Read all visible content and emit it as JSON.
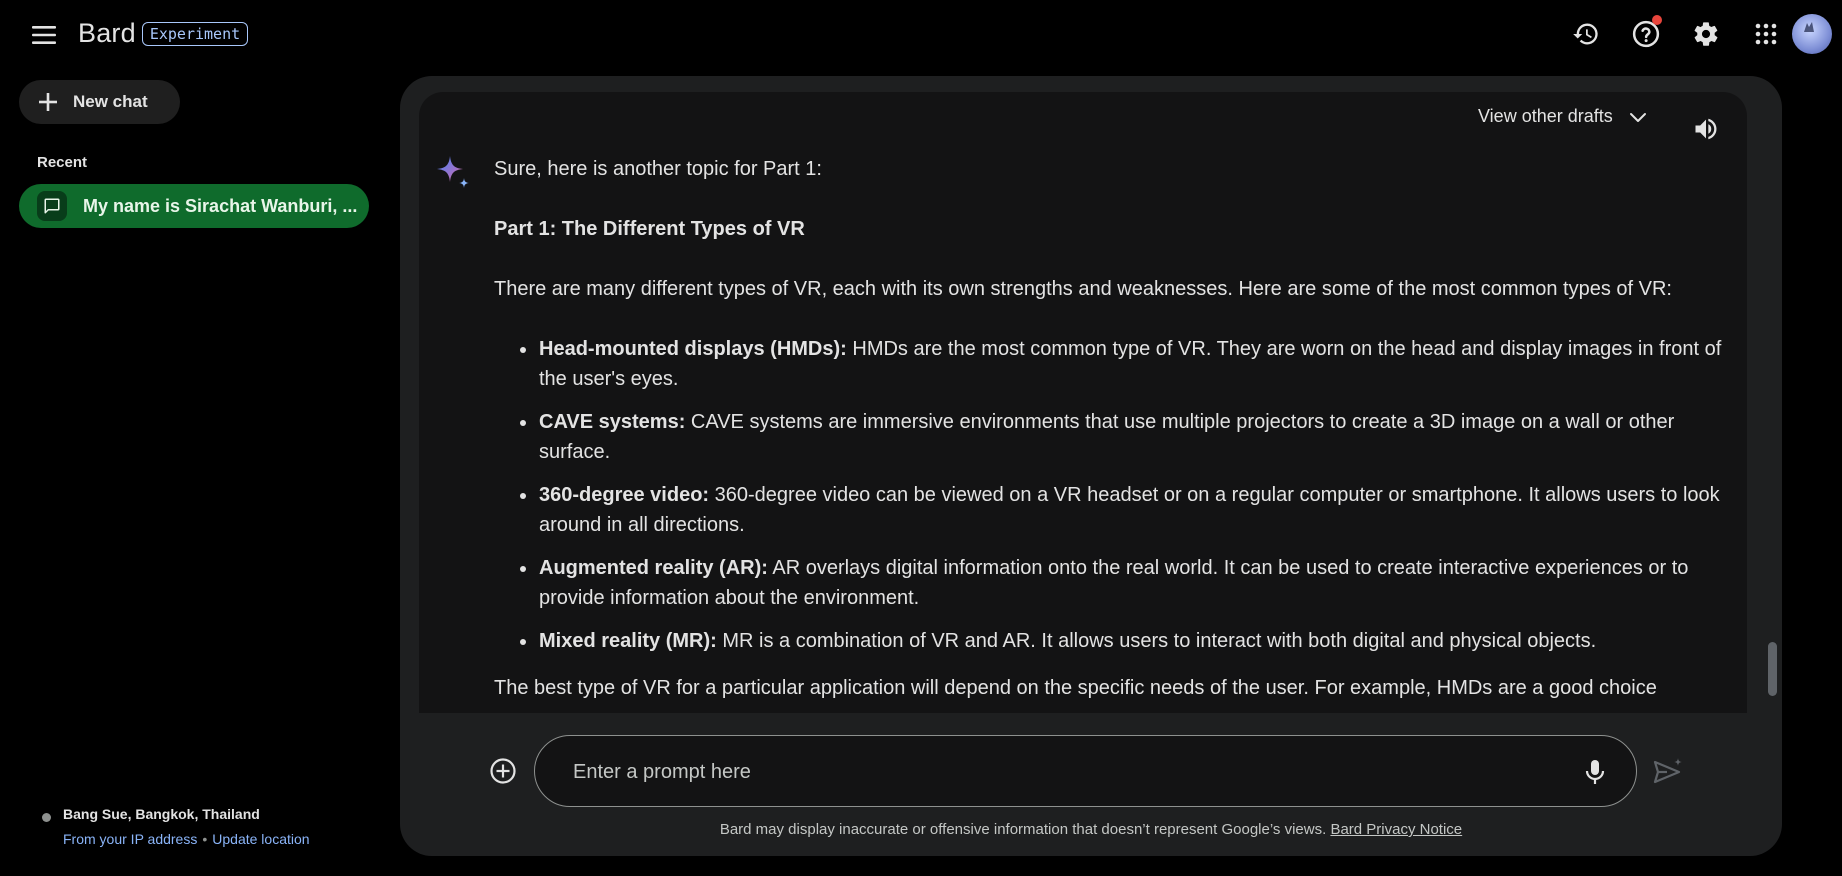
{
  "header": {
    "brand_name": "Bard",
    "badge": "Experiment",
    "icons": [
      "menu-icon",
      "history-icon",
      "help-icon",
      "settings-icon",
      "apps-grid-icon",
      "avatar"
    ],
    "notification_dot_color": "#e8453c"
  },
  "sidebar": {
    "new_chat_label": "New chat",
    "recent_label": "Recent",
    "recent_items": [
      {
        "label": "My name is Sirachat Wanburi, ..."
      }
    ],
    "active_item_color": "#0f6b2c",
    "location": {
      "place": "Bang Sue, Bangkok, Thailand",
      "source_link": "From your IP address",
      "separator": "•",
      "update_link": "Update location"
    }
  },
  "response": {
    "drafts_label": "View other drafts",
    "intro": "Sure, here is another topic for Part 1:",
    "heading": "Part 1: The Different Types of VR",
    "paragraph": "There are many different types of VR, each with its own strengths and weaknesses. Here are some of the most common types of VR:",
    "bullets": [
      {
        "term": "Head-mounted displays (HMDs):",
        "text": " HMDs are the most common type of VR. They are worn on the head and display images in front of the user's eyes."
      },
      {
        "term": "CAVE systems:",
        "text": " CAVE systems are immersive environments that use multiple projectors to create a 3D image on a wall or other surface."
      },
      {
        "term": "360-degree video:",
        "text": " 360-degree video can be viewed on a VR headset or on a regular computer or smartphone. It allows users to look around in all directions."
      },
      {
        "term": "Augmented reality (AR):",
        "text": " AR overlays digital information onto the real world. It can be used to create interactive experiences or to provide information about the environment."
      },
      {
        "term": "Mixed reality (MR):",
        "text": " MR is a combination of VR and AR. It allows users to interact with both digital and physical objects."
      }
    ],
    "last_paragraph": "The best type of VR for a particular application will depend on the specific needs of the user. For example, HMDs are a good choice"
  },
  "input": {
    "placeholder": "Enter a prompt here",
    "value": ""
  },
  "footer": {
    "disclaimer": "Bard may display inaccurate or offensive information that doesn’t represent Google’s views.",
    "privacy_link": "Bard Privacy Notice"
  }
}
